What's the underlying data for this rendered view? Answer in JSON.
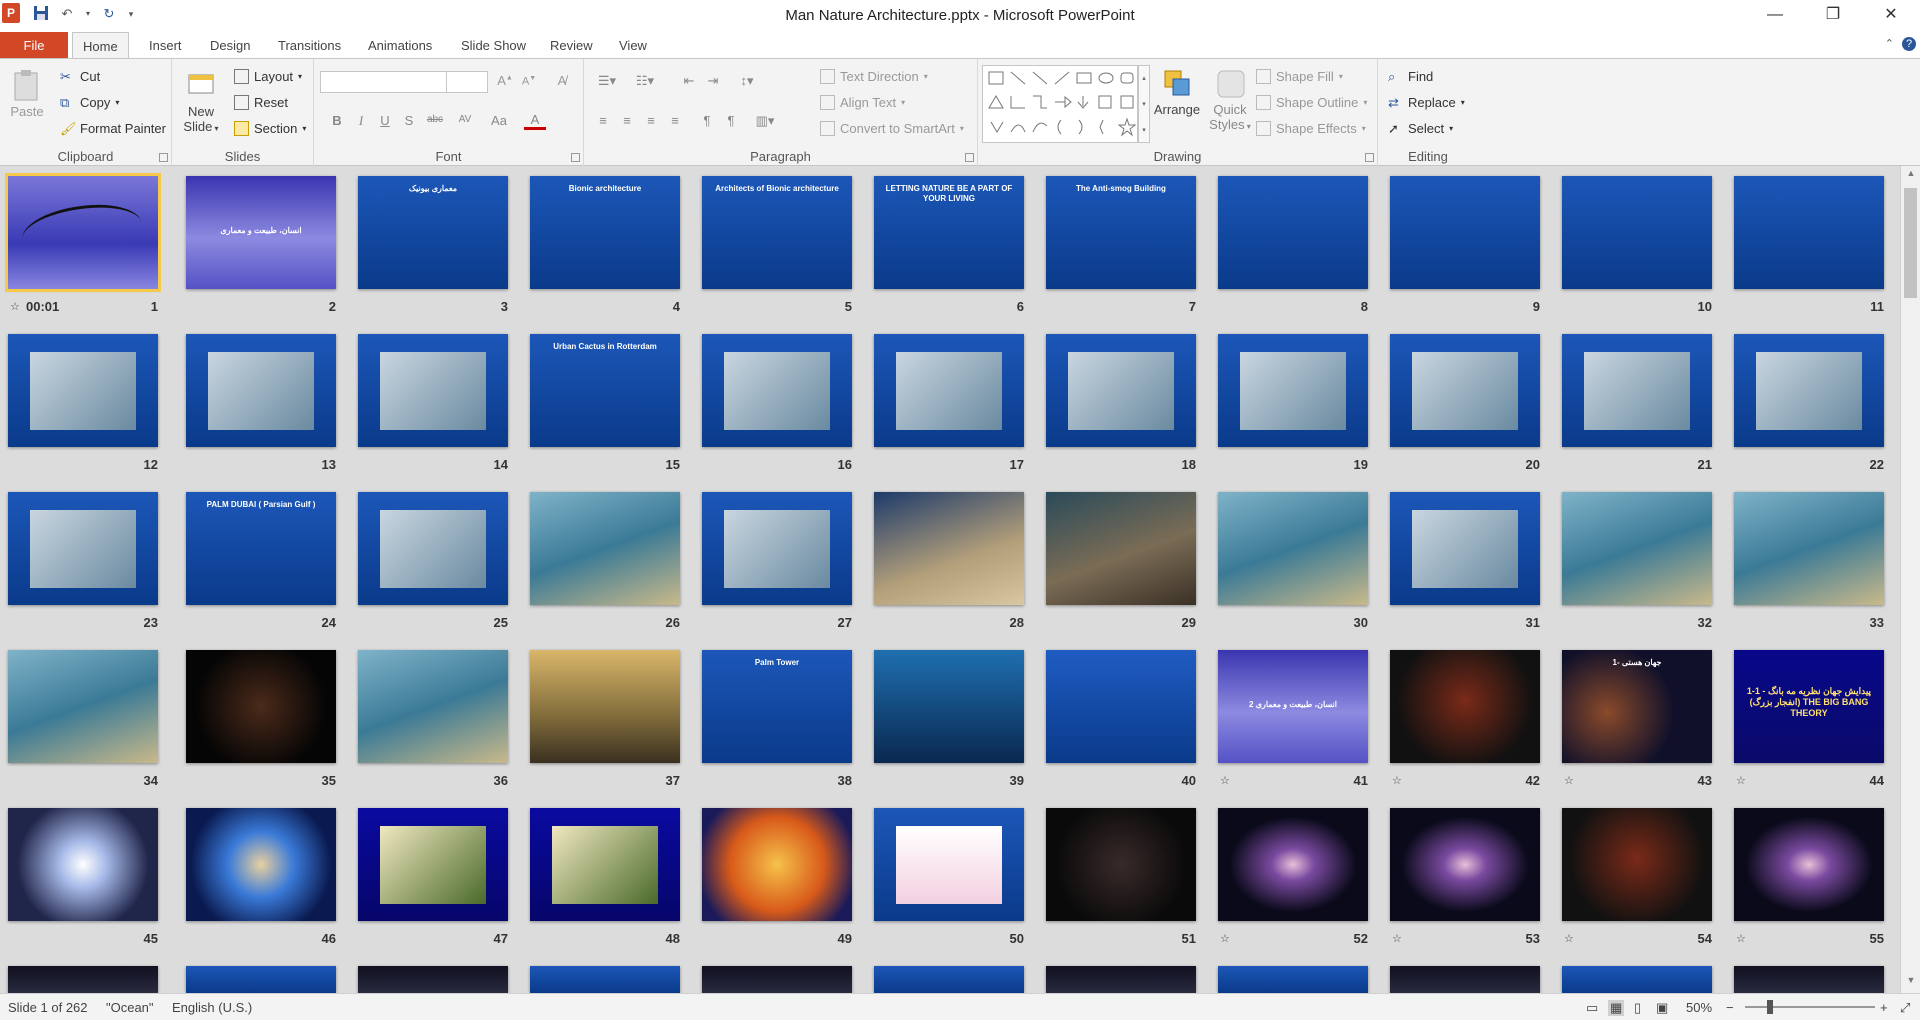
{
  "app": {
    "window_title": "Man Nature Architecture.pptx - Microsoft PowerPoint",
    "logo": "P"
  },
  "qat": {
    "save_icon": "save-icon",
    "undo_icon": "undo-icon",
    "redo_icon": "redo-icon",
    "customize_icon": "qat-customize-icon"
  },
  "tabs": {
    "file": "File",
    "items": [
      "Home",
      "Insert",
      "Design",
      "Transitions",
      "Animations",
      "Slide Show",
      "Review",
      "View"
    ],
    "active": "Home"
  },
  "ribbon": {
    "clipboard": {
      "label": "Clipboard",
      "paste": "Paste",
      "cut": "Cut",
      "copy": "Copy",
      "format_painter": "Format Painter"
    },
    "slides": {
      "label": "Slides",
      "new_slide_line1": "New",
      "new_slide_line2": "Slide",
      "layout": "Layout",
      "reset": "Reset",
      "section": "Section"
    },
    "font": {
      "label": "Font",
      "font_name": "",
      "font_size": "",
      "bold": "B",
      "italic": "I",
      "underline": "U",
      "strike": "S",
      "shadow": "abc",
      "spacing": "AV",
      "case": "Aa",
      "color": "A"
    },
    "paragraph": {
      "label": "Paragraph",
      "text_direction": "Text Direction",
      "align_text": "Align Text",
      "convert_smartart": "Convert to SmartArt"
    },
    "drawing": {
      "label": "Drawing",
      "arrange": "Arrange",
      "quick_styles_line1": "Quick",
      "quick_styles_line2": "Styles",
      "shape_fill": "Shape Fill",
      "shape_outline": "Shape Outline",
      "shape_effects": "Shape Effects"
    },
    "editing": {
      "label": "Editing",
      "find": "Find",
      "replace": "Replace",
      "select": "Select"
    }
  },
  "slides": [
    {
      "num": "1",
      "style": "calligraphy",
      "timing": "00:01"
    },
    {
      "num": "2",
      "style": "purple-title",
      "text": "انسان، طبیعت و معماری"
    },
    {
      "num": "3",
      "style": "blue-text-rtl",
      "text": "معماری بیونیک"
    },
    {
      "num": "4",
      "style": "blue-text",
      "text": "Bionic architecture"
    },
    {
      "num": "5",
      "style": "blue-text",
      "text": "Architects of Bionic architecture"
    },
    {
      "num": "6",
      "style": "blue-text",
      "text": "LETTING NATURE BE A PART OF YOUR LIVING"
    },
    {
      "num": "7",
      "style": "blue-text",
      "text": "The Anti-smog Building"
    },
    {
      "num": "8",
      "style": "blue-text",
      "text": ""
    },
    {
      "num": "9",
      "style": "blue-text",
      "text": ""
    },
    {
      "num": "10",
      "style": "blue-text",
      "text": ""
    },
    {
      "num": "11",
      "style": "blue-text",
      "text": ""
    },
    {
      "num": "12",
      "style": "blue-photo"
    },
    {
      "num": "13",
      "style": "blue-photo"
    },
    {
      "num": "14",
      "style": "blue-photo"
    },
    {
      "num": "15",
      "style": "blue-text",
      "text": "Urban Cactus in Rotterdam"
    },
    {
      "num": "16",
      "style": "blue-photo"
    },
    {
      "num": "17",
      "style": "blue-photo"
    },
    {
      "num": "18",
      "style": "blue-photo"
    },
    {
      "num": "19",
      "style": "blue-photo"
    },
    {
      "num": "20",
      "style": "blue-photo"
    },
    {
      "num": "21",
      "style": "blue-photo"
    },
    {
      "num": "22",
      "style": "blue-photo"
    },
    {
      "num": "23",
      "style": "blue-photo"
    },
    {
      "num": "24",
      "style": "blue-text",
      "text": "PALM DUBAI ( Parsian Gulf )"
    },
    {
      "num": "25",
      "style": "blue-photo"
    },
    {
      "num": "26",
      "style": "aerial"
    },
    {
      "num": "27",
      "style": "blue-photo"
    },
    {
      "num": "28",
      "style": "desert"
    },
    {
      "num": "29",
      "style": "desert-dark"
    },
    {
      "num": "30",
      "style": "aerial"
    },
    {
      "num": "31",
      "style": "blue-photo"
    },
    {
      "num": "32",
      "style": "aerial"
    },
    {
      "num": "33",
      "style": "aerial"
    },
    {
      "num": "34",
      "style": "aerial"
    },
    {
      "num": "35",
      "style": "night"
    },
    {
      "num": "36",
      "style": "aerial"
    },
    {
      "num": "37",
      "style": "gold"
    },
    {
      "num": "38",
      "style": "blue-text",
      "text": "Palm Tower"
    },
    {
      "num": "39",
      "style": "aquarium"
    },
    {
      "num": "40",
      "style": "blue-empty"
    },
    {
      "num": "41",
      "style": "purple-title",
      "text": "انسان، طبیعت و معماری 2",
      "star": true
    },
    {
      "num": "42",
      "style": "dark-red",
      "star": true
    },
    {
      "num": "43",
      "style": "space-text",
      "text": "1- جهان هستی",
      "star": true
    },
    {
      "num": "44",
      "style": "navy-text",
      "text": "1-1 - پیدایش جهان نظریه مه بانگ (انفجار بزرگ) THE BIG BANG THEORY",
      "star": true
    },
    {
      "num": "45",
      "style": "bright"
    },
    {
      "num": "46",
      "style": "nebula"
    },
    {
      "num": "47",
      "style": "navy-photo"
    },
    {
      "num": "48",
      "style": "navy-photo"
    },
    {
      "num": "49",
      "style": "orange"
    },
    {
      "num": "50",
      "style": "table"
    },
    {
      "num": "51",
      "style": "stars"
    },
    {
      "num": "52",
      "style": "galaxy",
      "star": true
    },
    {
      "num": "53",
      "style": "galaxy",
      "star": true
    },
    {
      "num": "54",
      "style": "dark-red",
      "star": true
    },
    {
      "num": "55",
      "style": "galaxy",
      "star": true
    }
  ],
  "status": {
    "slide_info": "Slide 1 of 262",
    "theme": "\"Ocean\"",
    "language": "English (U.S.)",
    "zoom": "50%",
    "zoom_level": 0.5
  }
}
